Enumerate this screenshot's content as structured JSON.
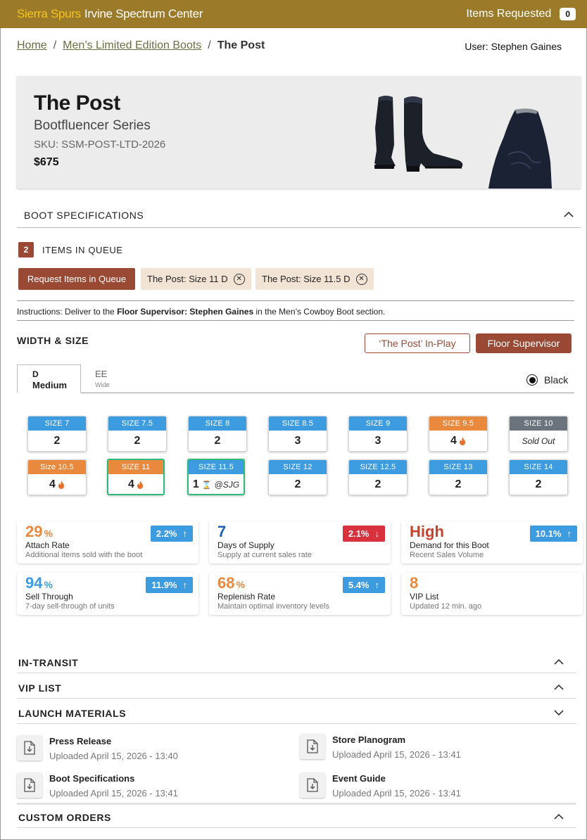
{
  "header": {
    "brand_primary": "Sierra Spurs",
    "brand_secondary": "Irvine Spectrum Center",
    "items_requested_label": "Items Requested",
    "items_requested_count": "0"
  },
  "breadcrumb": {
    "home": "Home",
    "category": "Men’s Limited Edition Boots",
    "current": "The Post",
    "separator": "/"
  },
  "user": "User: Stephen Gaines",
  "product": {
    "name": "The Post",
    "series": "Bootfluencer Series",
    "sku": "SKU: SSM-POST-LTD-2026",
    "price": "$675"
  },
  "sections": {
    "boot_specs": "BOOT SPECIFICATIONS",
    "width_size": "WIDTH & SIZE",
    "in_transit": "IN-TRANSIT",
    "vip_list": "VIP LIST",
    "launch_materials": "LAUNCH MATERIALS",
    "custom_orders": "CUSTOM ORDERS"
  },
  "queue": {
    "count": "2",
    "label": "ITEMS IN QUEUE",
    "request_button": "Request Items in Queue",
    "chips": [
      "The Post: Size 11 D",
      "The Post: Size 11.5 D"
    ]
  },
  "instructions": {
    "prefix": "Instructions: Deliver to the",
    "bold": "Floor Supervisor: Stephen Gaines",
    "suffix": "in the Men’s Cowboy Boot section."
  },
  "actions": {
    "in_play": "‘The Post’ In-Play",
    "floor_supervisor": "Floor Supervisor"
  },
  "tabs": {
    "d_code": "D",
    "d_name": "Medium",
    "ee_code": "EE",
    "ee_name": "Wide"
  },
  "color": "Black",
  "colors": {
    "blue": "#3d9be0",
    "orange": "#e8893d",
    "gray": "#6b737d",
    "green": "#2fb97a",
    "brick": "#9a4a34",
    "red": "#d8323f"
  },
  "sizes": [
    {
      "label": "SIZE 7",
      "value": "2",
      "status": "blue"
    },
    {
      "label": "SIZE 7.5",
      "value": "2",
      "status": "blue"
    },
    {
      "label": "SIZE 8",
      "value": "2",
      "status": "blue"
    },
    {
      "label": "SIZE 8.5",
      "value": "3",
      "status": "blue"
    },
    {
      "label": "SIZE 9",
      "value": "3",
      "status": "blue"
    },
    {
      "label": "SIZE 9.5",
      "value": "4",
      "status": "orange",
      "icon": "flame-icon"
    },
    {
      "label": "SIZE 10",
      "value": "Sold Out",
      "status": "gray"
    },
    {
      "label": "Size 10.5",
      "value": "4",
      "status": "orange",
      "icon": "flame-icon"
    },
    {
      "label": "SIZE 11",
      "value": "4",
      "status": "orange",
      "icon": "flame-icon",
      "selected": true
    },
    {
      "label": "SIZE 11.5",
      "value": "1",
      "status": "blue",
      "icon": "hourglass-icon",
      "tag": "@SJG",
      "selected": true
    },
    {
      "label": "SIZE 12",
      "value": "2",
      "status": "blue"
    },
    {
      "label": "SIZE 12.5",
      "value": "2",
      "status": "blue"
    },
    {
      "label": "SIZE 13",
      "value": "2",
      "status": "blue"
    },
    {
      "label": "SIZE 14",
      "value": "2",
      "status": "blue"
    }
  ],
  "metrics": [
    {
      "value": "29",
      "unit": "%",
      "color": "#e8893d",
      "label": "Attach Rate",
      "sub": "Additional items sold with the boot",
      "delta": "2.2%",
      "dir": "up",
      "delta_color": "#3d9be0"
    },
    {
      "value": "7",
      "unit": "",
      "color": "#1f5fb8",
      "label": "Days of Supply",
      "sub": "Supply at current sales rate",
      "delta": "2.1%",
      "dir": "down",
      "delta_color": "#d8323f"
    },
    {
      "value": "High",
      "unit": "",
      "color": "#c9402a",
      "label": "Demand for this Boot",
      "sub": "Recent Sales Volume",
      "delta": "10.1%",
      "dir": "up",
      "delta_color": "#3d9be0"
    },
    {
      "value": "94",
      "unit": "%",
      "color": "#3d9be0",
      "label": "Sell Through",
      "sub": "7-day sell-through of units",
      "delta": "11.9%",
      "dir": "up",
      "delta_color": "#3d9be0"
    },
    {
      "value": "68",
      "unit": "%",
      "color": "#e8893d",
      "label": "Replenish Rate",
      "sub": "Maintain optimal inventory levels",
      "delta": "5.4%",
      "dir": "up",
      "delta_color": "#3d9be0"
    },
    {
      "value": "8",
      "unit": "",
      "color": "#e8893d",
      "label": "VIP List",
      "sub": "Updated 12 min. ago",
      "delta": "",
      "dir": "",
      "delta_color": ""
    }
  ],
  "files": [
    {
      "name": "Press Release",
      "date": "Uploaded April 15, 2026 - 13:40"
    },
    {
      "name": "Store Planogram",
      "date": "Uploaded April 15, 2026 - 13:41"
    },
    {
      "name": "Boot Specifications",
      "date": "Uploaded April 15, 2026 - 13:41"
    },
    {
      "name": "Event Guide",
      "date": "Uploaded April 15, 2026 - 13:41"
    }
  ]
}
